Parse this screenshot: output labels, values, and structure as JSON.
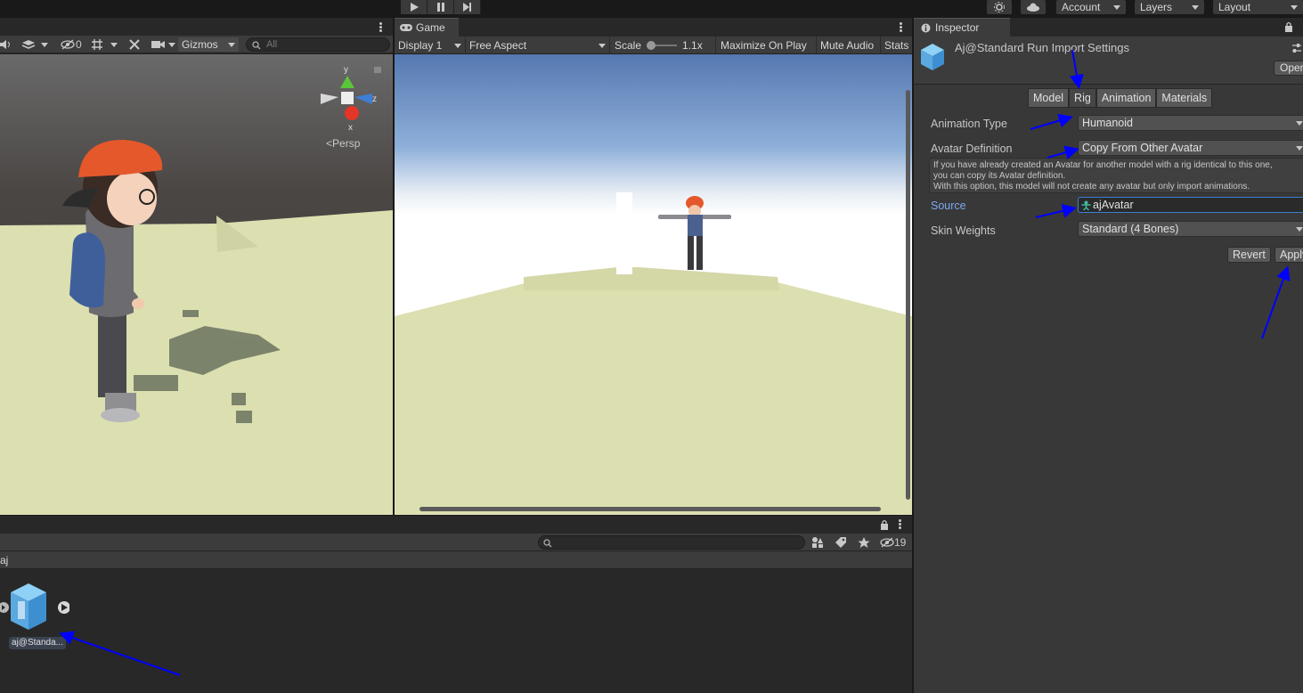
{
  "toolbar": {
    "account_label": "Account",
    "layers_label": "Layers",
    "layout_label": "Layout"
  },
  "scene": {
    "hidden_count": "0",
    "gizmos_label": "Gizmos",
    "search_placeholder": "All",
    "persp_label": "Persp",
    "axis_y": "y",
    "axis_z": "z",
    "axis_x": "x"
  },
  "game": {
    "tab_label": "Game",
    "display_label": "Display 1",
    "aspect_label": "Free Aspect",
    "scale_label": "Scale",
    "scale_value": "1.1x",
    "maximize_label": "Maximize On Play",
    "mute_label": "Mute Audio",
    "stats_label": "Stats"
  },
  "project": {
    "hidden_count": "19",
    "breadcrumb": "aj",
    "asset_name": "aj@Standa..."
  },
  "inspector": {
    "tab_label": "Inspector",
    "title": "Aj@Standard Run Import Settings",
    "open_label": "Open",
    "tabs": [
      "Model",
      "Rig",
      "Animation",
      "Materials"
    ],
    "animation_type_label": "Animation Type",
    "animation_type_value": "Humanoid",
    "avatar_definition_label": "Avatar Definition",
    "avatar_definition_value": "Copy From Other Avatar",
    "help_line1": "If you have already created an Avatar for another model with a rig identical to this one,",
    "help_line2": "you can copy its Avatar definition.",
    "help_line3": "With this option, this model will not create any avatar but only import animations.",
    "source_label": "Source",
    "source_value": "ajAvatar",
    "skin_weights_label": "Skin Weights",
    "skin_weights_value": "Standard (4 Bones)",
    "revert_label": "Revert",
    "apply_label": "Apply"
  },
  "colors": {
    "panel_bg": "#383838",
    "toolbar_bg": "#3c3c3c",
    "accent_blue": "#3d7fd6",
    "annotation_arrow": "#0000ff",
    "ground": "#dcdfb0"
  }
}
